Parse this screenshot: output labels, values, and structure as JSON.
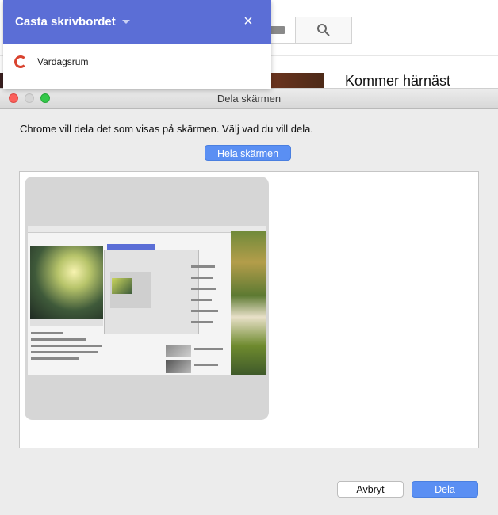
{
  "background": {
    "up_next_label": "Kommer härnäst",
    "search_icon": "search-icon",
    "keyboard_icon": "keyboard-icon"
  },
  "cast": {
    "title": "Casta skrivbordet",
    "close_icon": "close-icon",
    "caret_icon": "chevron-down-icon",
    "device": {
      "label": "Vardagsrum",
      "icon": "cast-device-icon"
    }
  },
  "dialog": {
    "title": "Dela skärmen",
    "prompt": "Chrome vill dela det som visas på skärmen. Välj vad du vill dela.",
    "tab_label": "Hela skärmen",
    "cancel_label": "Avbryt",
    "share_label": "Dela",
    "accent_color": "#5a8ff3",
    "traffic_lights": [
      "close",
      "minimize",
      "maximize"
    ]
  }
}
